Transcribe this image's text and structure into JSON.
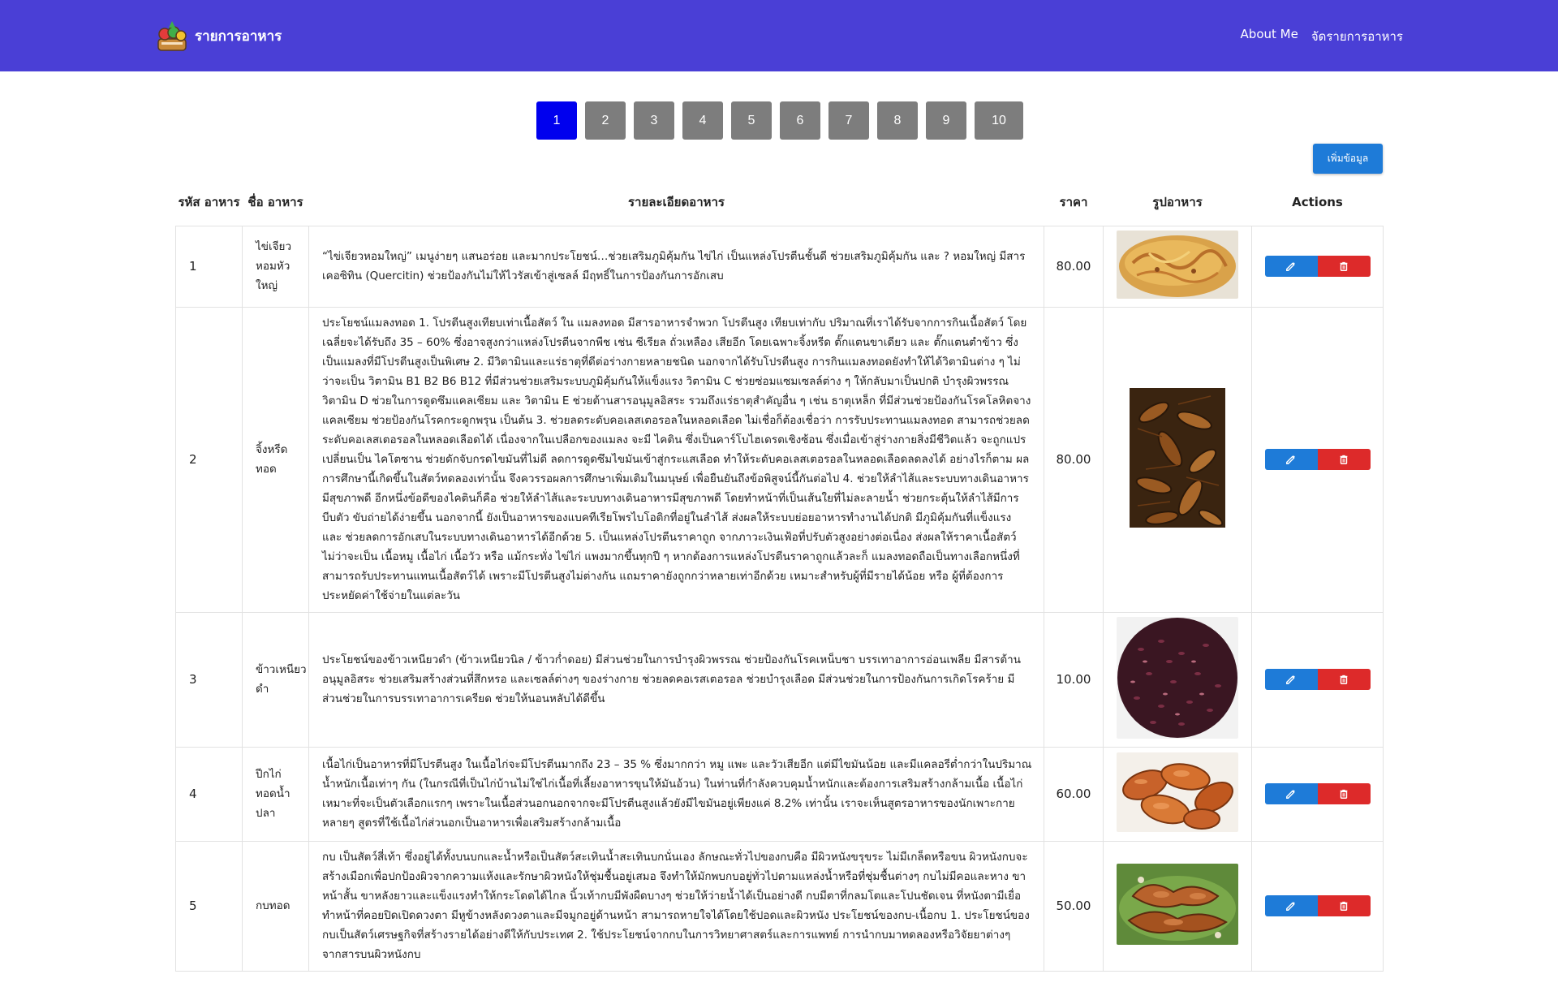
{
  "navbar": {
    "brand": "รายการอาหาร",
    "links": [
      "About Me",
      "จัดรายการอาหาร"
    ]
  },
  "pagination": {
    "pages": [
      "1",
      "2",
      "3",
      "4",
      "5",
      "6",
      "7",
      "8",
      "9",
      "10"
    ],
    "active": "1"
  },
  "add_button": "เพิ่มข้อมูล",
  "table": {
    "headers": {
      "id": "รหัส อาหาร",
      "name": "ชื่อ อาหาร",
      "detail": "รายละเอียดอาหาร",
      "price": "ราคา",
      "image": "รูปอาหาร",
      "actions": "Actions"
    },
    "rows": [
      {
        "id": "1",
        "name": "ไข่เจียวหอมหัวใหญ่",
        "detail": "“ไข่เจียวหอมใหญ่” เมนูง่ายๆ แสนอร่อย และมากประโยชน์…ช่วยเสริมภูมิคุ้มกัน ไข่ไก่ เป็นแหล่งโปรตีนชั้นดี ช่วยเสริมภูมิคุ้มกัน และ ? หอมใหญ่ มีสารเคอซิทิน (Quercitin) ช่วยป้องกันไม่ให้ไวรัสเข้าสู่เซลล์ มีฤทธิ์ในการป้องกันการอักเสบ",
        "price": "80.00",
        "image": "omelette-photo"
      },
      {
        "id": "2",
        "name": "จิ้งหรีดทอด",
        "detail": "ประโยชน์แมลงทอด 1. โปรตีนสูงเทียบเท่าเนื้อสัตว์ ใน แมลงทอด มีสารอาหารจำพวก โปรตีนสูง เทียบเท่ากับ ปริมาณที่เราได้รับจากการกินเนื้อสัตว์ โดยเฉลี่ยจะได้รับถึง 35 – 60% ซึ่งอาจสูงกว่าแหล่งโปรตีนจากพืช เช่น ซีเรียล ถั่วเหลือง เสียอีก โดยเฉพาะจิ้งหรีด ตั๊กแตนขาเดียว และ ตั๊กแตนตำข้าว ซึ่งเป็นแมลงที่มีโปรตีนสูงเป็นพิเศษ 2. มีวิตามินและแร่ธาตุที่ดีต่อร่างกายหลายชนิด นอกจากได้รับโปรตีนสูง การกินแมลงทอดยังทำให้ได้วิตามินต่าง ๆ ไม่ว่าจะเป็น วิตามิน B1 B2 B6 B12 ที่มีส่วนช่วยเสริมระบบภูมิคุ้มกันให้แข็งแรง วิตามิน C ช่วยซ่อมแซมเซลล์ต่าง ๆ ให้กลับมาเป็นปกติ บำรุงผิวพรรณ วิตามิน D ช่วยในการดูดซึมแคลเซียม และ วิตามิน E ช่วยต้านสารอนุมูลอิสระ รวมถึงแร่ธาตุสำคัญอื่น ๆ เช่น ธาตุเหล็ก ที่มีส่วนช่วยป้องกันโรคโลหิตจาง แคลเซียม ช่วยป้องกันโรคกระดูกพรุน เป็นต้น 3. ช่วยลดระดับคอเลสเตอรอลในหลอดเลือด ไม่เชื่อก็ต้องเชื่อว่า การรับประทานแมลงทอด สามารถช่วยลดระดับคอเลสเตอรอลในหลอดเลือดได้ เนื่องจากในเปลือกของแมลง จะมี ไคติน ซึ่งเป็นคาร์โบไฮเดรตเชิงซ้อน ซึ่งเมื่อเข้าสู่ร่างกายสิ่งมีชีวิตแล้ว จะถูกแปรเปลี่ยนเป็น ไคโตซาน ช่วยดักจับกรดไขมันที่ไม่ดี ลดการดูดซึมไขมันเข้าสู่กระแสเลือด ทำให้ระดับคอเลสเตอรอลในหลอดเลือดลดลงได้ อย่างไรก็ตาม ผลการศึกษานี้เกิดขึ้นในสัตว์ทดลองเท่านั้น จึงควรรอผลการศึกษาเพิ่มเติมในมนุษย์ เพื่อยืนยันถึงข้อพิสูจน์นี้กันต่อไป 4. ช่วยให้ลำไส้และระบบทางเดินอาหารมีสุขภาพดี อีกหนึ่งข้อดีของไคตินก็คือ ช่วยให้ลำไส้และระบบทางเดินอาหารมีสุขภาพดี โดยทำหน้าที่เป็นเส้นใยที่ไม่ละลายน้ำ ช่วยกระตุ้นให้ลำไส้มีการบีบตัว ขับถ่ายได้ง่ายขึ้น นอกจากนี้ ยังเป็นอาหารของแบคทีเรียโพรไบโอติกที่อยู่ในลำไส้ ส่งผลให้ระบบย่อยอาหารทำงานได้ปกติ มีภูมิคุ้มกันที่แข็งแรง และ ช่วยลดการอักเสบในระบบทางเดินอาหารได้อีกด้วย 5. เป็นแหล่งโปรตีนราคาถูก จากภาวะเงินเฟ้อที่ปรับตัวสูงอย่างต่อเนื่อง ส่งผลให้ราคาเนื้อสัตว์ ไม่ว่าจะเป็น เนื้อหมู เนื้อไก่ เนื้อวัว หรือ แม้กระทั่ง ไข่ไก่ แพงมากขึ้นทุกปี ๆ หากต้องการแหล่งโปรตีนราคาถูกแล้วละก็ แมลงทอดถือเป็นทางเลือกหนึ่งที่สามารถรับประทานแทนเนื้อสัตว์ได้ เพราะมีโปรตีนสูงไม่ต่างกัน แถมราคายังถูกกว่าหลายเท่าอีกด้วย เหมาะสำหรับผู้ที่มีรายได้น้อย หรือ ผู้ที่ต้องการประหยัดค่าใช้จ่ายในแต่ละวัน",
        "price": "80.00",
        "image": "fried-crickets-photo"
      },
      {
        "id": "3",
        "name": "ข้าวเหนียวดำ",
        "detail": "ประโยชน์ของข้าวเหนียวดำ (ข้าวเหนียวนิล / ข้าวก่ำดอย) มีส่วนช่วยในการบำรุงผิวพรรณ ช่วยป้องกันโรคเหน็บชา บรรเทาอาการอ่อนเพลีย มีสารต้านอนุมูลอิสระ ช่วยเสริมสร้างส่วนที่สึกหรอ และเซลล์ต่างๆ ของร่างกาย ช่วยลดคอเรสเตอรอล ช่วยบำรุงเลือด มีส่วนช่วยในการป้องกันการเกิดโรคร้าย มีส่วนช่วยในการบรรเทาอาการเครียด ช่วยให้นอนหลับได้ดีขึ้น",
        "price": "10.00",
        "image": "black-sticky-rice-photo"
      },
      {
        "id": "4",
        "name": "ปีกไก่ทอดน้ำปลา",
        "detail": "เนื้อไก่เป็นอาหารที่มีโปรตีนสูง ในเนื้อไก่จะมีโปรตีนมากถึง 23 – 35 % ซึ่งมากกว่า หมู แพะ และวัวเสียอีก แต่มีไขมันน้อย และมีแคลอรีต่ำกว่าในปริมาณน้ำหนักเนื้อเท่าๆ กัน (ในกรณีที่เป็นไก่บ้านไม่ใช่ไก่เนื้อที่เลี้ยงอาหารขุนให้มันอ้วน) ในท่านที่กำลังควบคุมน้ำหนักและต้องการเสริมสร้างกล้ามเนื้อ เนื้อไก่เหมาะที่จะเป็นตัวเลือกแรกๆ เพราะในเนื้อส่วนอกนอกจากจะมีโปรตีนสูงแล้วยังมีไขมันอยู่เพียงแค่ 8.2% เท่านั้น เราจะเห็นสูตรอาหารของนักเพาะกายหลายๆ สูตรที่ใช้เนื้อไก่ส่วนอกเป็นอาหารเพื่อเสริมสร้างกล้ามเนื้อ",
        "price": "60.00",
        "image": "fried-chicken-wings-photo"
      },
      {
        "id": "5",
        "name": "กบทอด",
        "detail": "กบ เป็นสัตว์สี่เท้า ซึ่งอยู่ได้ทั้งบนบกและน้ำหรือเป็นสัตว์สะเทินน้ำสะเทินบกนั่นเอง ลักษณะทั่วไปของกบคือ มีผิวหนังขรุขระ ไม่มีเกล็ดหรือขน ผิวหนังกบจะสร้างเมือกเพื่อปกป้องผิวจากความแห้งและรักษาผิวหนังให้ชุ่มชื้นอยู่เสมอ จึงทำให้มักพบกบอยู่ทั่วไปตามแหล่งน้ำหรือที่ชุ่มชื้นต่างๆ กบไม่มีคอและหาง ขาหน้าสั้น ขาหลังยาวและแข็งแรงทำให้กระโดดได้ไกล นิ้วเท้ากบมีพังผืดบางๆ ช่วยให้ว่ายน้ำได้เป็นอย่างดี กบมีตาที่กลมโตและโปนชัดเจน ที่หนังตามีเยื่อทำหน้าที่คอยปิดเปิดดวงตา มีหูข้างหลังดวงตาและมีจมูกอยู่ด้านหน้า สามารถหายใจได้โดยใช้ปอดและผิวหนัง ประโยชน์ของกบ-เนื้อกบ 1. ประโยชน์ของกบเป็นสัตว์เศรษฐกิจที่สร้างรายได้อย่างดีให้กับประเทศ 2. ใช้ประโยชน์จากกบในการวิทยาศาสตร์และการแพทย์ การนำกบมาทดลองหรือวิจัยยาต่างๆ จากสารบนผิวหนังกบ",
        "price": "50.00",
        "image": "fried-frog-photo"
      }
    ]
  }
}
